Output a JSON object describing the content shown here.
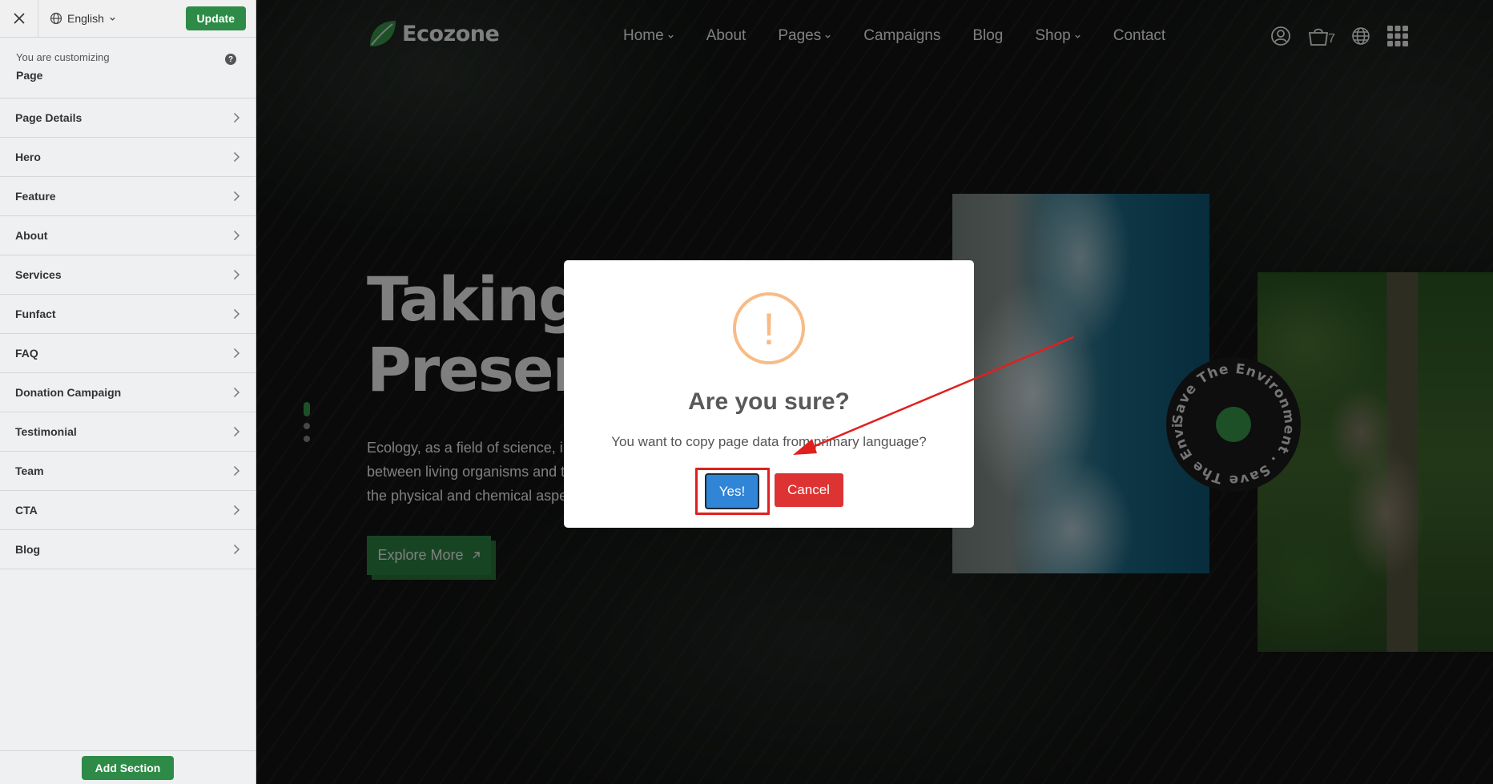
{
  "sidebar": {
    "language": "English",
    "update_label": "Update",
    "customizing_label": "You are customizing",
    "customizing_target": "Page",
    "help_symbol": "?",
    "items": [
      {
        "label": "Page Details"
      },
      {
        "label": "Hero"
      },
      {
        "label": "Feature"
      },
      {
        "label": "About"
      },
      {
        "label": "Services"
      },
      {
        "label": "Funfact"
      },
      {
        "label": "FAQ"
      },
      {
        "label": "Donation Campaign"
      },
      {
        "label": "Testimonial"
      },
      {
        "label": "Team"
      },
      {
        "label": "CTA"
      },
      {
        "label": "Blog"
      }
    ],
    "add_section_label": "Add Section"
  },
  "site": {
    "logo_text": "Ecozone",
    "nav": [
      {
        "label": "Home",
        "dropdown": true
      },
      {
        "label": "About",
        "dropdown": false
      },
      {
        "label": "Pages",
        "dropdown": true
      },
      {
        "label": "Campaigns",
        "dropdown": false
      },
      {
        "label": "Blog",
        "dropdown": false
      },
      {
        "label": "Shop",
        "dropdown": true
      },
      {
        "label": "Contact",
        "dropdown": false
      }
    ],
    "cart_count": "7",
    "hero": {
      "title_line1": "Taking S",
      "title_line2": "Preserve",
      "desc_line1": "Ecology, as a field of science, i",
      "desc_line2": "between living organisms and t",
      "desc_line3": "the physical and chemical aspe",
      "cta_label": "Explore More",
      "badge_text": "Save The Environment . Save The Environment ."
    }
  },
  "modal": {
    "icon_symbol": "!",
    "title": "Are you sure?",
    "message": "You want to copy page data from primary language?",
    "confirm_label": "Yes!",
    "cancel_label": "Cancel"
  },
  "colors": {
    "accent_green": "#2e8b47",
    "confirm_blue": "#3085d6",
    "cancel_red": "#dd3333",
    "warning_orange": "#f8bb86",
    "annotation_red": "#e0201e"
  }
}
